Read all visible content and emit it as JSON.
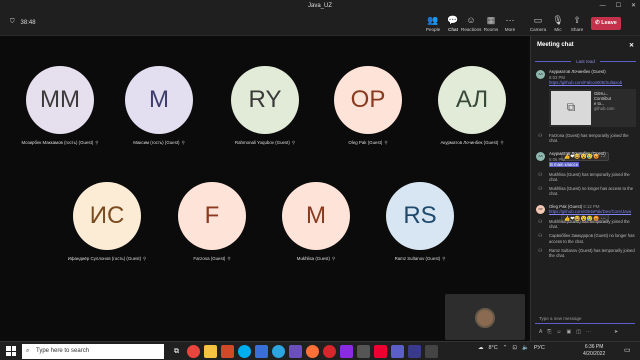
{
  "window": {
    "title": "Java_UZ"
  },
  "toolbar": {
    "timer": "38:48",
    "buttons": [
      {
        "label": "People",
        "icon": "people-icon",
        "glyph": "👥"
      },
      {
        "label": "Chat",
        "icon": "chat-icon",
        "glyph": "💬"
      },
      {
        "label": "Reactions",
        "icon": "reactions-icon",
        "glyph": "☺"
      },
      {
        "label": "Rooms",
        "icon": "rooms-icon",
        "glyph": "▦"
      },
      {
        "label": "More",
        "icon": "more-icon",
        "glyph": "⋯"
      },
      {
        "label": "Camera",
        "icon": "camera-icon",
        "glyph": "▭"
      },
      {
        "label": "Mic",
        "icon": "mic-icon",
        "glyph": "🎙"
      },
      {
        "label": "Share",
        "icon": "share-icon",
        "glyph": "⇪"
      }
    ],
    "leave": "Leave"
  },
  "participants": [
    {
      "initials": "MM",
      "name": "Мозирбек Маккамов (гость) (Guest)",
      "bg": "#e6e0ee",
      "fg": "#3b3b3b"
    },
    {
      "initials": "M",
      "name": "Максим (гость) (Guest)",
      "bg": "#e3def0",
      "fg": "#3d3d6e"
    },
    {
      "initials": "RY",
      "name": "Rahmonali Yoqubov (Guest)",
      "bg": "#e2ead8",
      "fg": "#3a3a3a"
    },
    {
      "initials": "OP",
      "name": "Oleg Pak (Guest)",
      "bg": "#fde3d8",
      "fg": "#8a3a1f"
    },
    {
      "initials": "АЛ",
      "name": "Акурматов Лочинбек (Guest)",
      "bg": "#e2ead8",
      "fg": "#3a4a3a"
    },
    {
      "initials": "ИС",
      "name": "Ифандиёр Суллонов (гость) (Guest)",
      "bg": "#fcecd6",
      "fg": "#7a4a20"
    },
    {
      "initials": "F",
      "name": "Farzona (Guest)",
      "bg": "#fde3d8",
      "fg": "#8a3a1f"
    },
    {
      "initials": "M",
      "name": "Mukhlisa (Guest)",
      "bg": "#fde3d8",
      "fg": "#8a3a1f"
    },
    {
      "initials": "RS",
      "name": "Ramz Sultanov (Guest)",
      "bg": "#d7e6f2",
      "fg": "#1f4a6e"
    }
  ],
  "chat": {
    "title": "Meeting chat",
    "last_read": "Last read",
    "msg1": {
      "author": "Акурматов Лочинбек (Guest)",
      "time": "6:03 PM",
      "link": "https://github.com/Falcon005/Sultaxob",
      "card_title": "GitHu...",
      "card_sub1": "Contribut",
      "card_sub2": "e to...",
      "card_src": "github.com"
    },
    "sys1": "Farzona (Guest) has temporarily joined the chat.",
    "msg2": {
      "author": "Акурматов Лочинбек (Guest)",
      "time": "6:06 PM",
      "text": "В main классе"
    },
    "sys2": "Mukhlisa (Guest) has temporarily joined the chat.",
    "sys3": "Mukhlisa (Guest) no longer has access to the chat.",
    "msg3": {
      "author": "Oleg Pak (Guest)",
      "time": "6:12 PM",
      "link": "https://github.com/OletsPak/Dev/Core/Java"
    },
    "sys4": "Mukhlisa (Guest) has temporarily joined the chat.",
    "sys5": "Сарвоббек Замодоров (Guest) no longer has access to the chat.",
    "sys6": "Ramz Sultanov (Guest) has temporarily joined the chat.",
    "compose_placeholder": "Type a new message"
  },
  "taskbar": {
    "search_placeholder": "Type here to search",
    "weather": "8°C",
    "lang": "РУС",
    "time": "6:36 PM",
    "date": "4/20/2022"
  }
}
